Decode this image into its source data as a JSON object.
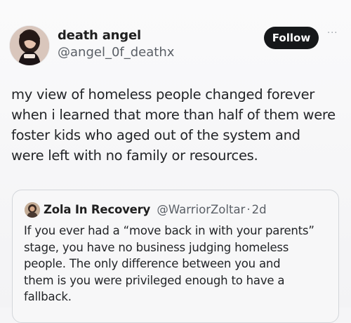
{
  "tweet": {
    "author": {
      "display_name": "death angel",
      "handle": "@angel_0f_deathx",
      "avatar_icon": "profile-photo"
    },
    "follow_label": "Follow",
    "more_icon": "ellipsis-icon",
    "more_label": "···",
    "text_lines": [
      "my view of homeless people changed forever",
      "when i learned that more than half of them were",
      "foster kids who aged out of the system and",
      "were left with no family or resources."
    ]
  },
  "quote": {
    "author": {
      "display_name": "Zola In Recovery",
      "handle": "@WarriorZoltar",
      "separator": "·",
      "timestamp": "2d",
      "avatar_icon": "profile-photo"
    },
    "text_lines": [
      "If you ever had a “move back in with your parents”",
      "stage, you have no business judging homeless",
      "people. The only difference between you and",
      "them is you were privileged enough to have a",
      "fallback."
    ]
  },
  "colors": {
    "background": "#f5f5f7",
    "follow_button": "#16181a",
    "text_primary": "#222427",
    "text_secondary": "#5a5f66",
    "quote_border": "#d3d6da"
  }
}
